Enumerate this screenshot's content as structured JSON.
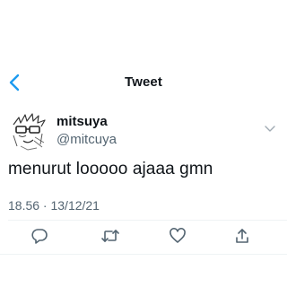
{
  "header": {
    "title": "Tweet",
    "back_icon": "chevron-left-icon",
    "accent_color": "#1d9bf0"
  },
  "author": {
    "display_name": "mitsuya",
    "handle": "@mitcuya",
    "avatar_icon": "avatar-drawing",
    "menu_icon": "chevron-down-icon"
  },
  "tweet": {
    "text": "menurut looooo ajaaa gmn",
    "timestamp": "18.56 · 13/12/21"
  },
  "actions": {
    "reply_icon": "reply-icon",
    "retweet_icon": "retweet-icon",
    "like_icon": "like-icon",
    "share_icon": "share-icon",
    "icon_color": "#536471"
  }
}
